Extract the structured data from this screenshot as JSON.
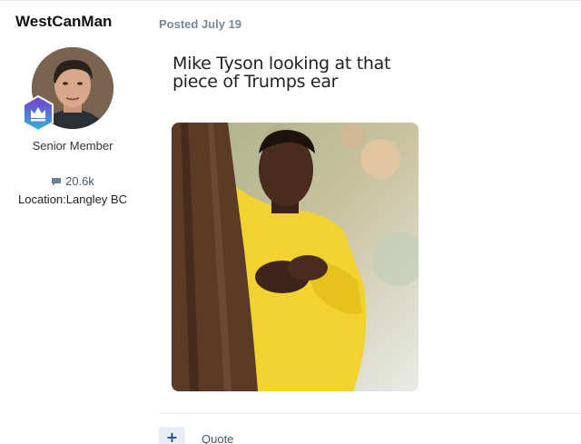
{
  "author": {
    "username": "WestCanMan",
    "rank": "Senior Member",
    "post_count": "20.6k",
    "location": "Location:Langley BC",
    "badge_icon": "crown-badge-icon",
    "avatar_icon": "user-avatar"
  },
  "post": {
    "posted_label": "Posted July 19",
    "meme_caption": "Mike Tyson looking at that piece of Trumps ear"
  },
  "actions": {
    "add_label": "+",
    "quote_label": "Quote"
  },
  "colors": {
    "badge_gradient_top": "#7a3bd0",
    "badge_gradient_bottom": "#2fb4d8",
    "meta_text": "#7a8699",
    "button_bg": "#e9eef6",
    "button_text": "#1f4f9a",
    "jacket_yellow": "#f2d22e"
  }
}
